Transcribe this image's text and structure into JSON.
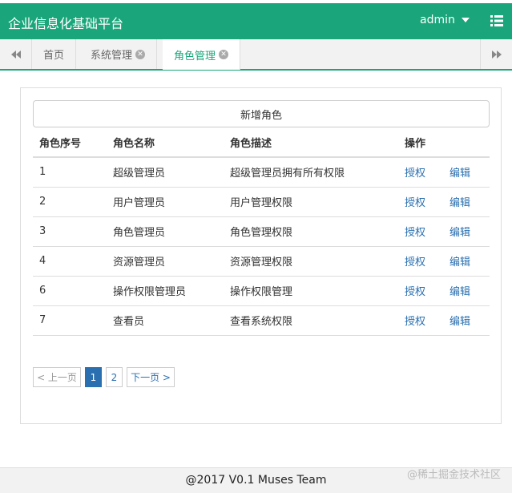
{
  "app": {
    "title": "企业信息化基础平台",
    "user": "admin"
  },
  "tabs": [
    {
      "label": "首页"
    },
    {
      "label": "系统管理"
    },
    {
      "label": "角色管理"
    }
  ],
  "main": {
    "add_button": "新增角色",
    "columns": [
      "角色序号",
      "角色名称",
      "角色描述",
      "操作"
    ],
    "actions": {
      "authorize": "授权",
      "edit": "编辑"
    },
    "rows": [
      {
        "id": "1",
        "name": "超级管理员",
        "desc": "超级管理员拥有所有权限"
      },
      {
        "id": "2",
        "name": "用户管理员",
        "desc": "用户管理权限"
      },
      {
        "id": "3",
        "name": "角色管理员",
        "desc": "角色管理权限"
      },
      {
        "id": "4",
        "name": "资源管理员",
        "desc": "资源管理权限"
      },
      {
        "id": "6",
        "name": "操作权限管理员",
        "desc": "操作权限管理"
      },
      {
        "id": "7",
        "name": "查看员",
        "desc": "查看系统权限"
      }
    ]
  },
  "pagination": {
    "prev": "< 上一页",
    "pages": [
      "1",
      "2"
    ],
    "next": "下一页 >"
  },
  "footer": {
    "text": "@2017 V0.1 Muses Team",
    "watermark": "@稀土掘金技术社区"
  }
}
